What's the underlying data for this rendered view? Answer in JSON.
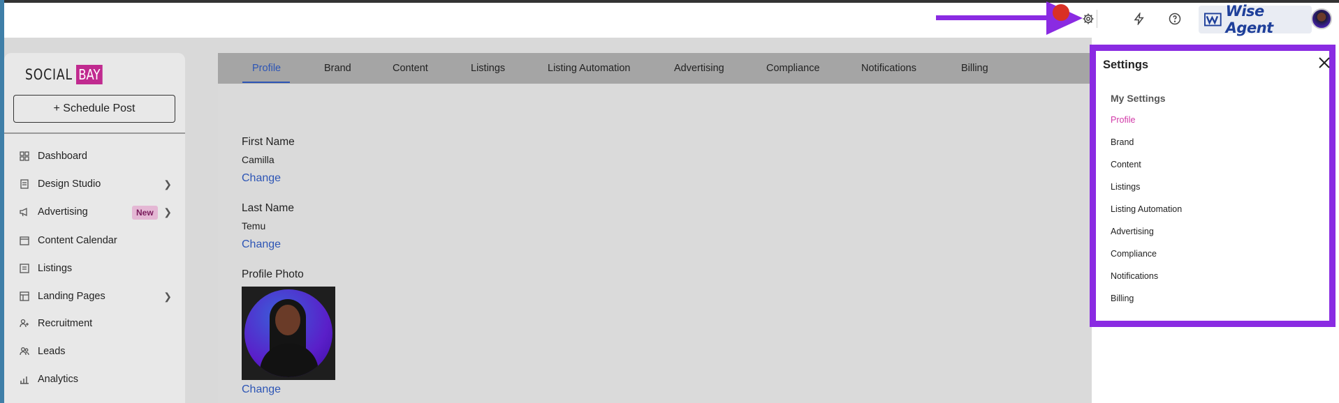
{
  "topbar": {
    "icons": [
      "gear-icon",
      "lightning-icon",
      "help-icon"
    ],
    "brand_name": "Wise Agent"
  },
  "sidebar": {
    "logo_social": "SOCIAL",
    "logo_bay": "BAY",
    "schedule_label": "+ Schedule Post",
    "items": [
      {
        "label": "Dashboard",
        "icon": "dashboard-icon"
      },
      {
        "label": "Design Studio",
        "icon": "document-icon"
      },
      {
        "label": "Advertising",
        "icon": "megaphone-icon",
        "badge": "New"
      },
      {
        "label": "Content Calendar",
        "icon": "calendar-icon"
      },
      {
        "label": "Listings",
        "icon": "list-icon"
      },
      {
        "label": "Landing Pages",
        "icon": "layout-icon"
      },
      {
        "label": "Recruitment",
        "icon": "add-user-icon"
      },
      {
        "label": "Leads",
        "icon": "users-icon"
      },
      {
        "label": "Analytics",
        "icon": "bar-chart-icon"
      }
    ]
  },
  "main": {
    "tabs": [
      "Profile",
      "Brand",
      "Content",
      "Listings",
      "Listing Automation",
      "Advertising",
      "Compliance",
      "Notifications",
      "Billing"
    ],
    "first_name_label": "First Name",
    "first_name_value": "Camilla",
    "last_name_label": "Last Name",
    "last_name_value": "Temu",
    "photo_label": "Profile Photo",
    "change_label": "Change"
  },
  "settings_panel": {
    "title": "Settings",
    "subtitle": "My Settings",
    "items": [
      "Profile",
      "Brand",
      "Content",
      "Listings",
      "Listing Automation",
      "Advertising",
      "Compliance",
      "Notifications",
      "Billing"
    ]
  },
  "colors": {
    "accent_purple": "#8a2be2",
    "link_blue": "#2d55b5",
    "active_pink": "#d23aa8",
    "brand_magenta": "#c02a8f"
  }
}
